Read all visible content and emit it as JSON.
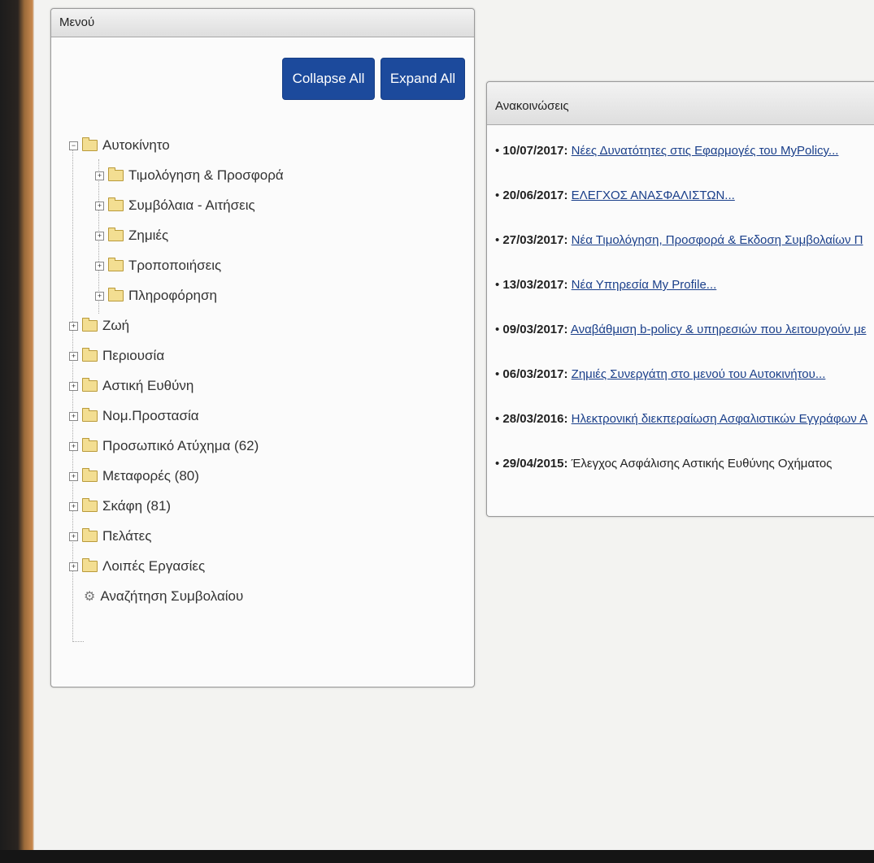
{
  "menu": {
    "title": "Μενού",
    "collapse_label": "Collapse All",
    "expand_label": "Expand All",
    "items": [
      {
        "label": "Αυτοκίνητο",
        "expanded": true,
        "children": [
          "Τιμολόγηση & Προσφορά",
          "Συμβόλαια - Αιτήσεις",
          "Ζημιές",
          "Τροποποιήσεις",
          "Πληροφόρηση"
        ]
      },
      {
        "label": "Ζωή"
      },
      {
        "label": "Περιουσία"
      },
      {
        "label": "Αστική Ευθύνη"
      },
      {
        "label": "Νομ.Προστασία"
      },
      {
        "label": "Προσωπικό Ατύχημα (62)"
      },
      {
        "label": "Μεταφορές (80)"
      },
      {
        "label": "Σκάφη (81)"
      },
      {
        "label": "Πελάτες"
      },
      {
        "label": "Λοιπές Εργασίες"
      },
      {
        "label": "Αναζήτηση Συμβολαίου",
        "icon": "gear-icon"
      }
    ]
  },
  "announcements": {
    "title": "Ανακοινώσεις",
    "items": [
      {
        "date": "10/07/2017:",
        "text": "Νέες Δυνατότητες στις Εφαρμογές του MyPolicy..."
      },
      {
        "date": "20/06/2017:",
        "text": "ΕΛΕΓΧΟΣ ΑΝΑΣΦΑΛΙΣΤΩΝ..."
      },
      {
        "date": "27/03/2017:",
        "text": "Νέα Τιμολόγηση, Προσφορά & Εκδοση Συμβολαίων Π"
      },
      {
        "date": "13/03/2017:",
        "text": "Νέα Υπηρεσία My Profile..."
      },
      {
        "date": "09/03/2017:",
        "text": "Αναβάθμιση b-policy & υπηρεσιών που λειτουργούν με"
      },
      {
        "date": "06/03/2017:",
        "text": "Ζημιές Συνεργάτη στο μενού του Αυτοκινήτου..."
      },
      {
        "date": "28/03/2016:",
        "text": "Ηλεκτρονική διεκπεραίωση Ασφαλιστικών Εγγράφων Α"
      },
      {
        "date": "29/04/2015:",
        "text": "Έλεγχος Ασφάλισης Αστικής Ευθύνης Οχήματος"
      }
    ]
  }
}
